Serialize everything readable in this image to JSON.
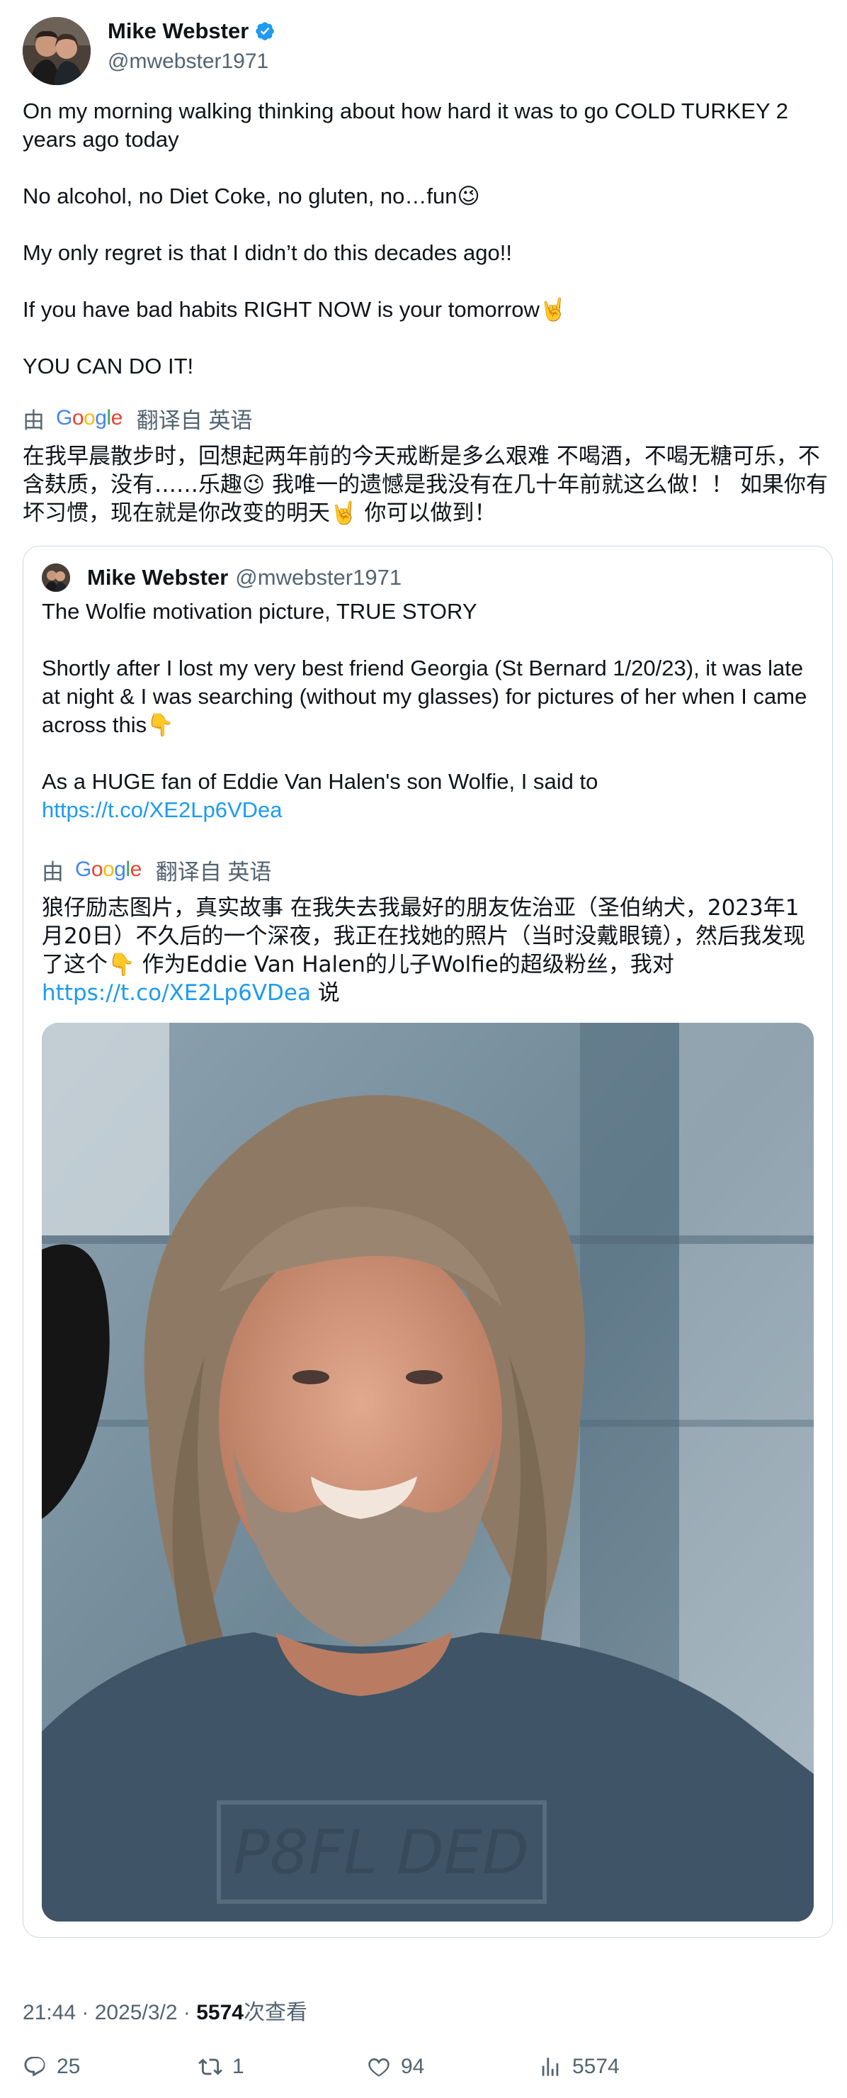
{
  "author": {
    "display_name": "Mike Webster",
    "handle": "@mwebster1971",
    "verified": true,
    "verified_color": "#1d9bf0"
  },
  "tweet": {
    "paragraphs": [
      "On my morning walking thinking about how hard it was to go COLD TURKEY 2 years ago today",
      "No alcohol, no Diet Coke, no gluten, no…fun😉",
      "My only regret is that I didn’t do this decades ago!!",
      "If you have bad habits RIGHT NOW is your tomorrow🤘",
      "YOU CAN DO IT!"
    ],
    "translation": {
      "by_label": "由",
      "provider": "Google",
      "from_label": "翻译自 英语",
      "text": "在我早晨散步时，回想起两年前的今天戒断是多么艰难 不喝酒，不喝无糖可乐，不含麸质，没有……乐趣😉 我唯一的遗憾是我没有在几十年前就这么做！！ 如果你有坏习惯，现在就是你改变的明天🤘 你可以做到！"
    }
  },
  "quote": {
    "display_name": "Mike Webster",
    "handle": "@mwebster1971",
    "paragraphs": [
      "The Wolfie motivation picture, TRUE STORY",
      "Shortly after I lost my very best friend Georgia (St Bernard 1/20/23), it was late at night & I was searching (without my glasses) for pictures of her when I came across this👇"
    ],
    "last_paragraph": "As a HUGE fan of Eddie Van Halen's son Wolfie, I said to",
    "link": "https://t.co/XE2Lp6VDea",
    "translation": {
      "by_label": "由",
      "provider": "Google",
      "from_label": "翻译自 英语",
      "text": "狼仔励志图片，真实故事 在我失去我最好的朋友佐治亚（圣伯纳犬，2023年1月20日）不久后的一个深夜，我正在找她的照片（当时没戴眼镜），然后我发现了这个👇 作为Eddie Van Halen的儿子Wolfie的超级粉丝，我对",
      "link": "https://t.co/XE2Lp6VDea",
      "suffix": " 说"
    },
    "image_shirt_text": "P8FL DED"
  },
  "meta": {
    "time": "21:44",
    "separator": " · ",
    "date": "2025/3/2",
    "views_count": "5574",
    "views_label": "次查看"
  },
  "actions": {
    "replies": "25",
    "reposts": "1",
    "likes": "94",
    "views": "5574"
  }
}
